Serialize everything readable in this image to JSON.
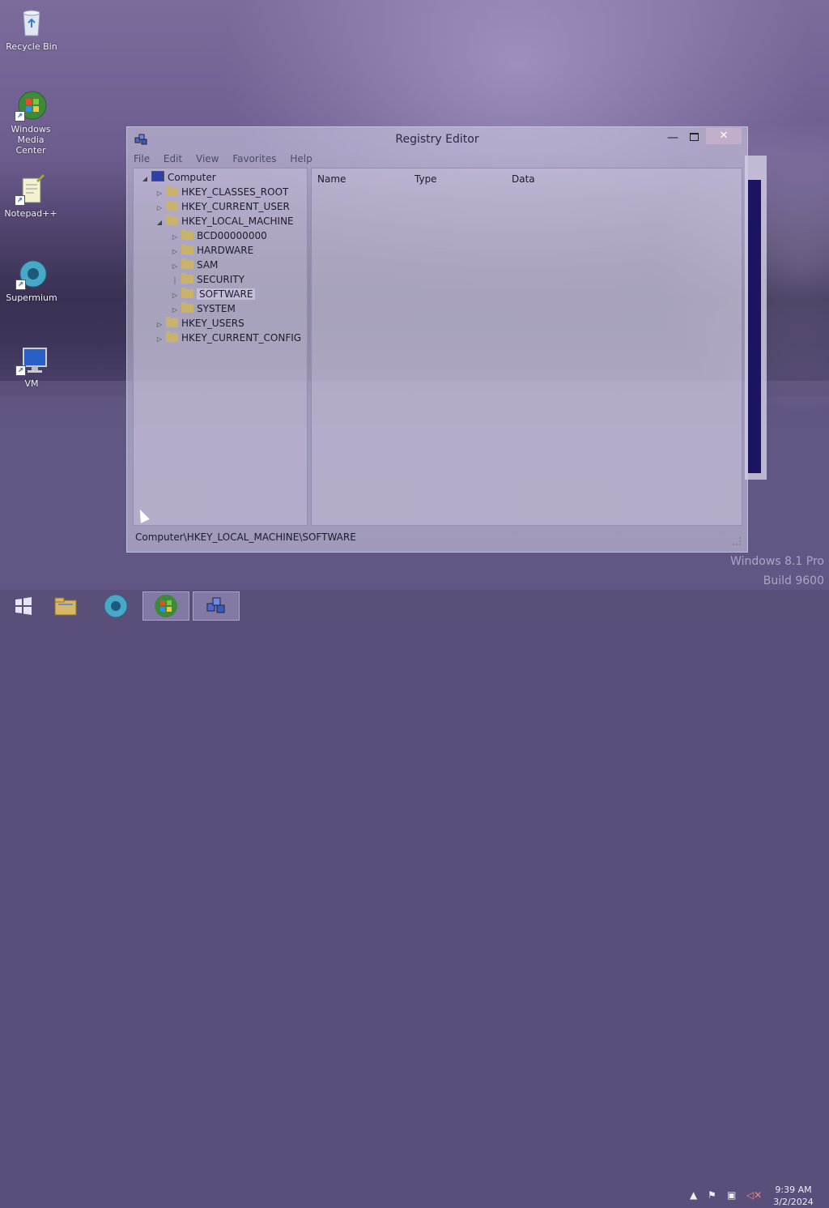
{
  "desktop": {
    "icons": [
      {
        "label": "Recycle Bin",
        "icon": "recycle-bin-icon"
      },
      {
        "label": "Windows Media Center",
        "icon": "windows-media-center-icon"
      },
      {
        "label": "Notepad++",
        "icon": "notepadpp-icon"
      },
      {
        "label": "Supermium",
        "icon": "supermium-icon"
      },
      {
        "label": "VM",
        "icon": "vm-icon"
      }
    ],
    "watermark": {
      "line1": "Windows 8.1 Pro",
      "line2": "Build 9600"
    }
  },
  "window": {
    "title": "Registry Editor",
    "close_glyph": "✕",
    "minimize_glyph": "—",
    "menu": [
      "File",
      "Edit",
      "View",
      "Favorites",
      "Help"
    ],
    "tree": {
      "root": "Computer",
      "hives": [
        "HKEY_CLASSES_ROOT",
        "HKEY_CURRENT_USER",
        "HKEY_LOCAL_MACHINE",
        "HKEY_USERS",
        "HKEY_CURRENT_CONFIG"
      ],
      "hklm_children": [
        "BCD00000000",
        "HARDWARE",
        "SAM",
        "SECURITY",
        "SOFTWARE",
        "SYSTEM"
      ],
      "selected": "SOFTWARE"
    },
    "columns": [
      "Name",
      "Type",
      "Data"
    ],
    "status_path": "Computer\\HKEY_LOCAL_MACHINE\\SOFTWARE"
  },
  "taskbar": {
    "buttons": [
      "start-button",
      "file-explorer",
      "supermium",
      "windows-media-center",
      "registry-editor"
    ],
    "active": "registry-editor",
    "clock": {
      "time": "9:39 AM",
      "date": "3/2/2024"
    }
  },
  "colors": {
    "selected_bg": "#d2c8e6",
    "close_button": "#ccb4cd",
    "taskbar": "#584e78"
  }
}
